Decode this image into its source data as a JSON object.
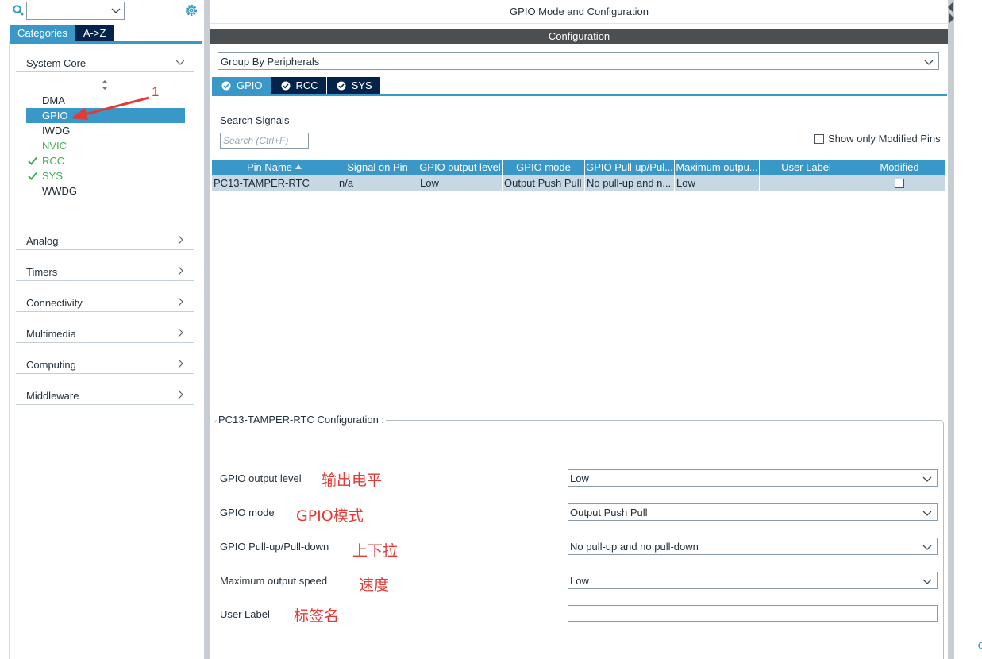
{
  "left": {
    "search_value": "",
    "category_tabs": [
      {
        "label": "Categories",
        "active": true
      },
      {
        "label": "A->Z",
        "active": false
      }
    ],
    "system_core": {
      "label": "System Core",
      "items": [
        {
          "label": "DMA",
          "selected": false,
          "enabled": false
        },
        {
          "label": "GPIO",
          "selected": true,
          "enabled": false
        },
        {
          "label": "IWDG",
          "selected": false,
          "enabled": false
        },
        {
          "label": "NVIC",
          "selected": false,
          "enabled": false,
          "green": true
        },
        {
          "label": "RCC",
          "selected": false,
          "enabled": true
        },
        {
          "label": "SYS",
          "selected": false,
          "enabled": true
        },
        {
          "label": "WWDG",
          "selected": false,
          "enabled": false
        }
      ]
    },
    "sections": [
      "Analog",
      "Timers",
      "Connectivity",
      "Multimedia",
      "Computing",
      "Middleware"
    ],
    "annotation_number": "1"
  },
  "main": {
    "title": "GPIO Mode and Configuration",
    "config_bar": "Configuration",
    "group_by": "Group By Peripherals",
    "tabs": [
      "GPIO",
      "RCC",
      "SYS"
    ],
    "search_signals_label": "Search Signals",
    "search_placeholder": "Search (Ctrl+F)",
    "show_modified_label": "Show only Modified Pins",
    "table": {
      "headers": [
        "Pin Name",
        "Signal on Pin",
        "GPIO output level",
        "GPIO mode",
        "GPIO Pull-up/Pul...",
        "Maximum outpu...",
        "User Label",
        "Modified"
      ],
      "rows": [
        [
          "PC13-TAMPER-RTC",
          "n/a",
          "Low",
          "Output Push Pull",
          "No pull-up and n...",
          "Low",
          "",
          ""
        ]
      ]
    },
    "pin_config": {
      "legend": "PC13-TAMPER-RTC Configuration :",
      "fields": [
        {
          "label": "GPIO output level",
          "note": "输出电平",
          "value": "Low"
        },
        {
          "label": "GPIO mode",
          "note": "GPIO模式",
          "value": "Output Push Pull"
        },
        {
          "label": "GPIO Pull-up/Pull-down",
          "note": "上下拉",
          "value": "No pull-up and no pull-down"
        },
        {
          "label": "Maximum output speed",
          "note": "速度",
          "value": "Low"
        },
        {
          "label": "User Label",
          "note": "标签名",
          "value": ""
        }
      ]
    }
  },
  "colors": {
    "accent": "#3a98c9",
    "dark_tab": "#03234b",
    "config_bar": "#4b4f52",
    "annotation": "#e53935",
    "enabled_green": "#3bb04f"
  }
}
